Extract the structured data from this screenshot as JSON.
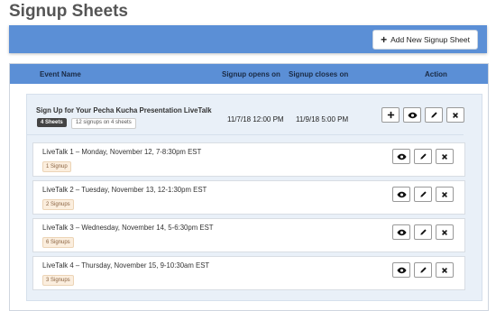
{
  "page": {
    "title": "Signup Sheets"
  },
  "toolbar": {
    "add_label": "Add New Signup Sheet"
  },
  "table": {
    "headers": [
      "Event Name",
      "Signup opens on",
      "Signup closes on",
      "Action"
    ]
  },
  "event": {
    "title": "Sign Up for Your Pecha Kucha Presentation LiveTalk",
    "sheets_badge": "4 Sheets",
    "signups_badge": "12 signups on 4 sheets",
    "opens": "11/7/18 12:00 PM",
    "closes": "11/9/18 5:00 PM"
  },
  "sheets": [
    {
      "label": "LiveTalk 1 – Monday, November 12, 7-8:30pm EST",
      "badge": "1 Signup"
    },
    {
      "label": "LiveTalk 2 – Tuesday, November 13, 12-1:30pm EST",
      "badge": "2 Signups"
    },
    {
      "label": "LiveTalk 3 – Wednesday, November 14, 5-6:30pm EST",
      "badge": "6 Signups"
    },
    {
      "label": "LiveTalk 4 – Thursday, November 15, 9-10:30am EST",
      "badge": "3 Signups"
    }
  ]
}
